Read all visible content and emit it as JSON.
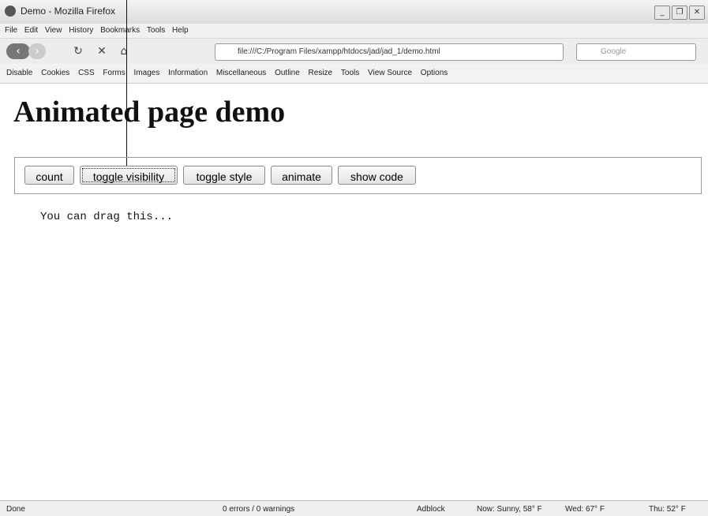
{
  "window": {
    "title": "Demo - Mozilla Firefox"
  },
  "menubar": [
    "File",
    "Edit",
    "View",
    "History",
    "Bookmarks",
    "Tools",
    "Help"
  ],
  "navbar": {
    "url": "file:///C:/Program Files/xampp/htdocs/jad/jad_1/demo.html",
    "search_placeholder": "Google"
  },
  "devbar": [
    "Disable",
    "Cookies",
    "CSS",
    "Forms",
    "Images",
    "Information",
    "Miscellaneous",
    "Outline",
    "Resize",
    "Tools",
    "View Source",
    "Options"
  ],
  "page": {
    "heading": "Animated page demo",
    "buttons": [
      "count",
      "toggle visibility",
      "toggle style",
      "animate",
      "show code"
    ],
    "drag_text": "You can drag this..."
  },
  "status": {
    "done": "Done",
    "errors": "0 errors / 0 warnings",
    "adblock": "Adblock",
    "now": "Now: Sunny, 58° F",
    "wed": "Wed: 67° F",
    "thu": "Thu: 52° F"
  }
}
